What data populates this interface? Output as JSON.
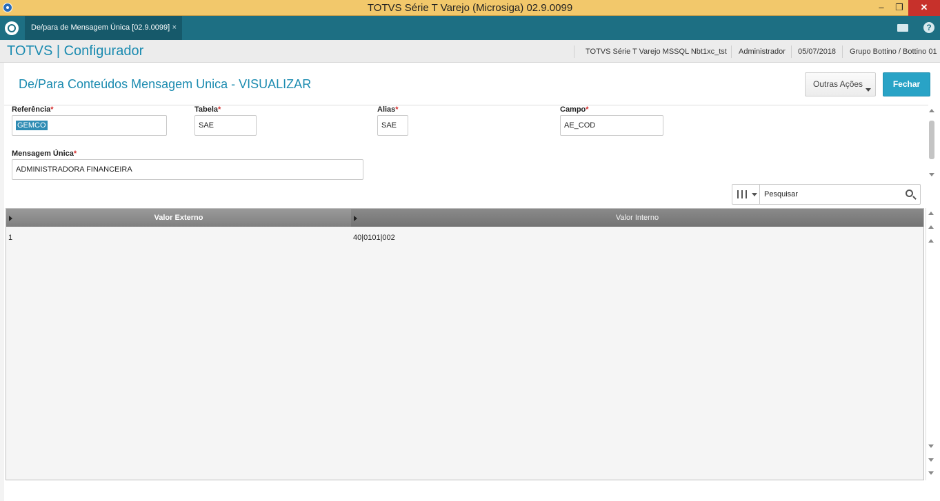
{
  "window": {
    "title": "TOTVS Série T Varejo (Microsiga) 02.9.0099",
    "minimize": "–",
    "restore": "❐",
    "close": "✕"
  },
  "tabbar": {
    "tab_label": "De/para de Mensagem Única [02.9.0099]",
    "tab_close": "×",
    "help": "?"
  },
  "header": {
    "brand": "TOTVS | Configurador",
    "environment": "TOTVS Série T Varejo MSSQL Nbt1xc_tst",
    "user": "Administrador",
    "date": "05/07/2018",
    "company": "Grupo Bottino / Bottino 01"
  },
  "page": {
    "title": "De/Para Conteúdos Mensagem Unica - VISUALIZAR",
    "outras_acoes": "Outras Ações",
    "fechar": "Fechar"
  },
  "form": {
    "referencia": {
      "label": "Referência",
      "required": "*",
      "value": "GEMCO"
    },
    "tabela": {
      "label": "Tabela",
      "required": "*",
      "value": "SAE"
    },
    "alias": {
      "label": "Alias",
      "required": "*",
      "value": "SAE"
    },
    "campo": {
      "label": "Campo",
      "required": "*",
      "value": "AE_COD"
    },
    "mensagem_unica": {
      "label": "Mensagem Única",
      "required": "*",
      "value": "ADMINISTRADORA FINANCEIRA"
    }
  },
  "search": {
    "placeholder": "Pesquisar"
  },
  "grid": {
    "columns": [
      "Valor Externo",
      "Valor Interno"
    ],
    "rows": [
      [
        "1",
        "40|0101|002"
      ]
    ]
  }
}
